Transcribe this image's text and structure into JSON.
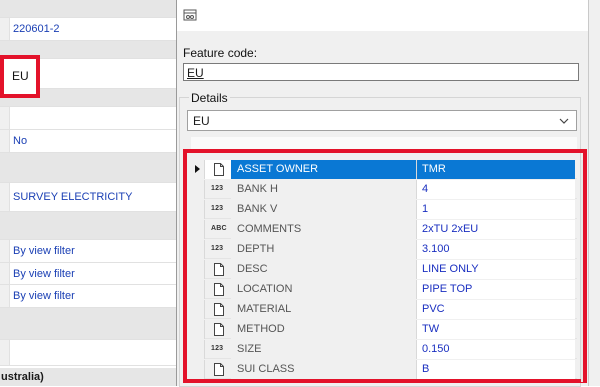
{
  "background_grid": {
    "rows": [
      {
        "text": "220601-2",
        "kind": "value"
      },
      {
        "text": "",
        "kind": "category"
      },
      {
        "text": "EU",
        "kind": "highlighted"
      },
      {
        "text": "",
        "kind": "category"
      },
      {
        "text": "",
        "kind": "value"
      },
      {
        "text": "No",
        "kind": "value"
      },
      {
        "text": "",
        "kind": "category"
      },
      {
        "text": "SURVEY ELECTRICITY",
        "kind": "value"
      },
      {
        "text": "",
        "kind": "category"
      },
      {
        "text": "By view filter",
        "kind": "value"
      },
      {
        "text": "By view filter",
        "kind": "value"
      },
      {
        "text": "By view filter",
        "kind": "value"
      },
      {
        "text": "",
        "kind": "category"
      },
      {
        "text": "",
        "kind": "value"
      }
    ],
    "bottom_text": "ustralia)"
  },
  "dialog": {
    "titlebar_icon": "feature-code-icon",
    "feature_code_label": "Feature code:",
    "feature_code_value": "EU",
    "details_label": "Details",
    "details_select_value": "EU",
    "attributes": [
      {
        "name": "ASSET OWNER",
        "value": "TMR",
        "type": "doc",
        "selected": true
      },
      {
        "name": "BANK H",
        "value": "4",
        "type": "123"
      },
      {
        "name": "BANK V",
        "value": "1",
        "type": "123"
      },
      {
        "name": "COMMENTS",
        "value": "2xTU 2xEU",
        "type": "ABC"
      },
      {
        "name": "DEPTH",
        "value": "3.100",
        "type": "123"
      },
      {
        "name": "DESC",
        "value": "LINE ONLY",
        "type": "doc"
      },
      {
        "name": "LOCATION",
        "value": "PIPE TOP",
        "type": "doc"
      },
      {
        "name": "MATERIAL",
        "value": "PVC",
        "type": "doc"
      },
      {
        "name": "METHOD",
        "value": "TW",
        "type": "doc"
      },
      {
        "name": "SIZE",
        "value": "0.150",
        "type": "123"
      },
      {
        "name": "SUI CLASS",
        "value": "B",
        "type": "doc"
      }
    ]
  },
  "colors": {
    "highlight_frame": "#e3122a",
    "selection": "#0a78d4",
    "value_text": "#1a2fc0"
  }
}
